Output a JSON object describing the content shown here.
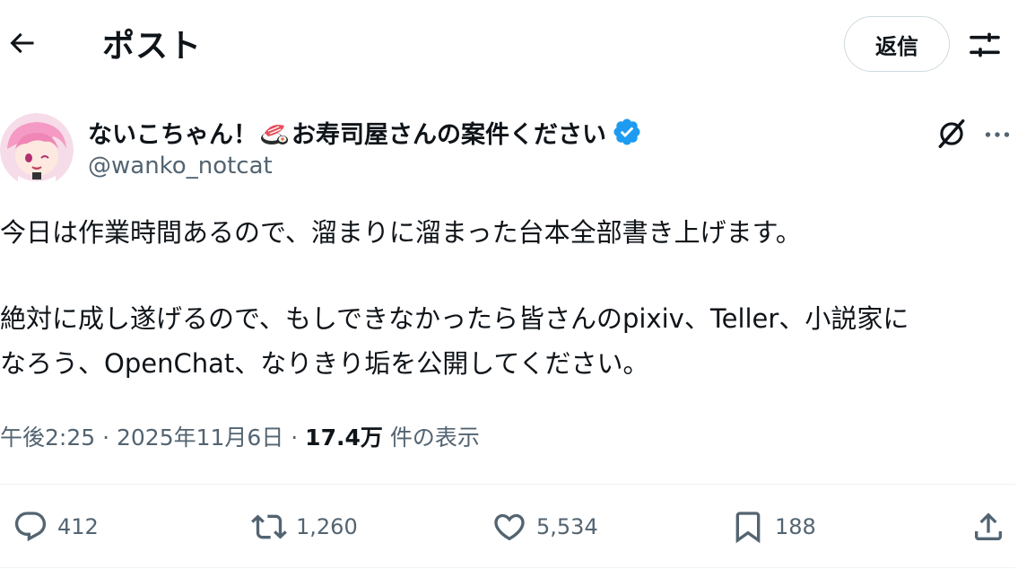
{
  "header": {
    "title": "ポスト",
    "reply_label": "返信"
  },
  "author": {
    "display_name": "ないこちゃん！",
    "display_name_suffix": "お寿司屋さんの案件ください",
    "handle": "@wanko_notcat"
  },
  "post": {
    "line1": "今日は作業時間あるので、溜まりに溜まった台本全部書き上げます。",
    "line2": "絶対に成し遂げるので、もしできなかったら皆さんのpixiv、Teller、小説家に",
    "line3": "なろう、OpenChat、なりきり垢を公開してください。",
    "time": "午後2:25",
    "sep1": " · ",
    "date": "2025年11月6日",
    "sep2": " · ",
    "views_count": "17.4万",
    "views_label": "件の表示"
  },
  "actions": {
    "replies": "412",
    "reposts": "1,260",
    "likes": "5,534",
    "bookmarks": "188"
  },
  "colors": {
    "text": "#0f1419",
    "muted": "#536471",
    "verified": "#1d9bf0",
    "border": "#cfd9de"
  }
}
